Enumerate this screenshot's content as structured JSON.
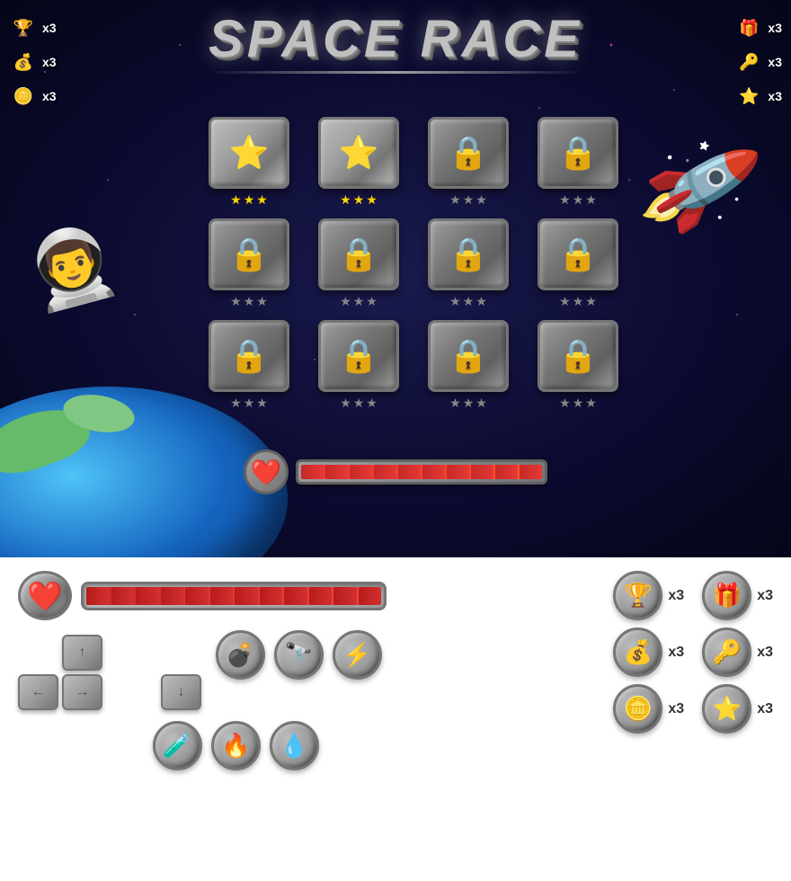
{
  "title": "SPACE RACE",
  "top_left_items": [
    {
      "icon": "🏆",
      "count": "x3"
    },
    {
      "icon": "💰",
      "count": "x3"
    },
    {
      "icon": "🪙",
      "count": "x3"
    }
  ],
  "top_right_items": [
    {
      "icon": "🎁",
      "count": "x3"
    },
    {
      "icon": "🔑",
      "count": "x3"
    },
    {
      "icon": "⭐",
      "count": "x3"
    }
  ],
  "levels": [
    {
      "type": "star",
      "stars": 3,
      "locked": false
    },
    {
      "type": "star",
      "stars": 3,
      "locked": false
    },
    {
      "type": "lock",
      "stars": 0,
      "locked": true
    },
    {
      "type": "lock",
      "stars": 0,
      "locked": true
    },
    {
      "type": "lock",
      "stars": 0,
      "locked": true
    },
    {
      "type": "lock",
      "stars": 0,
      "locked": true
    },
    {
      "type": "lock",
      "stars": 0,
      "locked": true
    },
    {
      "type": "lock",
      "stars": 0,
      "locked": true
    },
    {
      "type": "lock",
      "stars": 0,
      "locked": true
    },
    {
      "type": "lock",
      "stars": 0,
      "locked": true
    },
    {
      "type": "lock",
      "stars": 0,
      "locked": true
    },
    {
      "type": "lock",
      "stars": 0,
      "locked": true
    }
  ],
  "health": {
    "fill_percent": 90,
    "segments": 10,
    "ui_segments": 12
  },
  "ui_counters": [
    {
      "icon": "🏆",
      "count": "x3"
    },
    {
      "icon": "🎁",
      "count": "x3"
    },
    {
      "icon": "💰",
      "count": "x3"
    },
    {
      "icon": "🔑",
      "count": "x3"
    },
    {
      "icon": "🪙",
      "count": "x3"
    },
    {
      "icon": "⭐",
      "count": "x3"
    }
  ],
  "ui_items": [
    {
      "icon": "💣",
      "label": "bomb"
    },
    {
      "icon": "🔭",
      "label": "telescope"
    },
    {
      "icon": "⚡",
      "label": "lightning"
    }
  ],
  "ui_bottom_items": [
    {
      "icon": "🧪",
      "label": "potion"
    },
    {
      "icon": "🔥",
      "label": "fire"
    },
    {
      "icon": "💧",
      "label": "drop"
    }
  ],
  "arrows": [
    {
      "symbol": "↑",
      "label": "up"
    },
    {
      "symbol": "←",
      "label": "left"
    },
    {
      "symbol": "→",
      "label": "right"
    },
    {
      "symbol": "↓",
      "label": "down"
    }
  ]
}
